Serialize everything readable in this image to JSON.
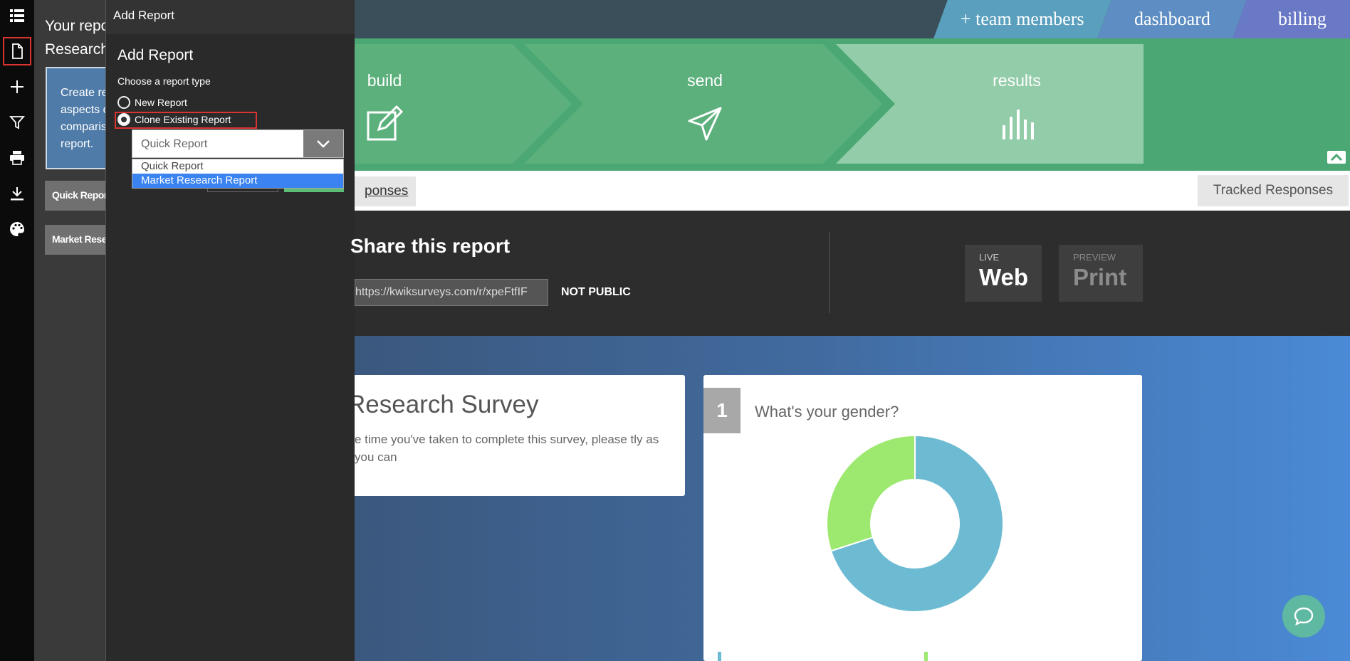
{
  "rail": {
    "items": [
      "list-icon",
      "document-icon",
      "plus-icon",
      "filter-icon",
      "print-icon",
      "download-icon",
      "palette-icon"
    ]
  },
  "reports_panel": {
    "title_line1": "Your repo",
    "title_line2": "Research",
    "info_lines": [
      "Create re",
      "aspects o",
      "comparis",
      "report."
    ],
    "items": [
      "Quick Report",
      "Market Resea"
    ]
  },
  "add_report": {
    "topbar_title": "Add Report",
    "heading": "Add Report",
    "choose_label": "Choose a report type",
    "options": [
      {
        "label": "New Report",
        "checked": false
      },
      {
        "label": "Clone Existing Report",
        "checked": true
      }
    ],
    "select": {
      "value": "Quick Report",
      "options": [
        "Quick Report",
        "Market Research Report"
      ],
      "highlighted": "Market Research Report"
    }
  },
  "topbar": {
    "tabs": [
      "+ team members",
      "dashboard",
      "billing"
    ]
  },
  "steps": [
    {
      "label": "build",
      "icon": "edit-icon"
    },
    {
      "label": "send",
      "icon": "paper-plane-icon"
    },
    {
      "label": "results",
      "icon": "bar-chart-icon"
    }
  ],
  "subnav": {
    "responses_tab": "ponses",
    "tracked_button": "Tracked Responses"
  },
  "share": {
    "title": "Share this report",
    "url": "https://kwiksurveys.com/r/xpeFtfIF",
    "status": "NOT PUBLIC",
    "live": {
      "small": "LIVE",
      "big": "Web"
    },
    "preview": {
      "small": "PREVIEW",
      "big": "Print"
    }
  },
  "survey": {
    "title": "Research Survey",
    "description": "e time you've taken to complete this survey, please tly as you can"
  },
  "question": {
    "number": "1",
    "text": "What's your gender?"
  },
  "chart_data": {
    "type": "pie",
    "categories": [
      "",
      ""
    ],
    "values": [
      70,
      30
    ],
    "colors": [
      "#6dbbd3",
      "#9de96f"
    ]
  }
}
